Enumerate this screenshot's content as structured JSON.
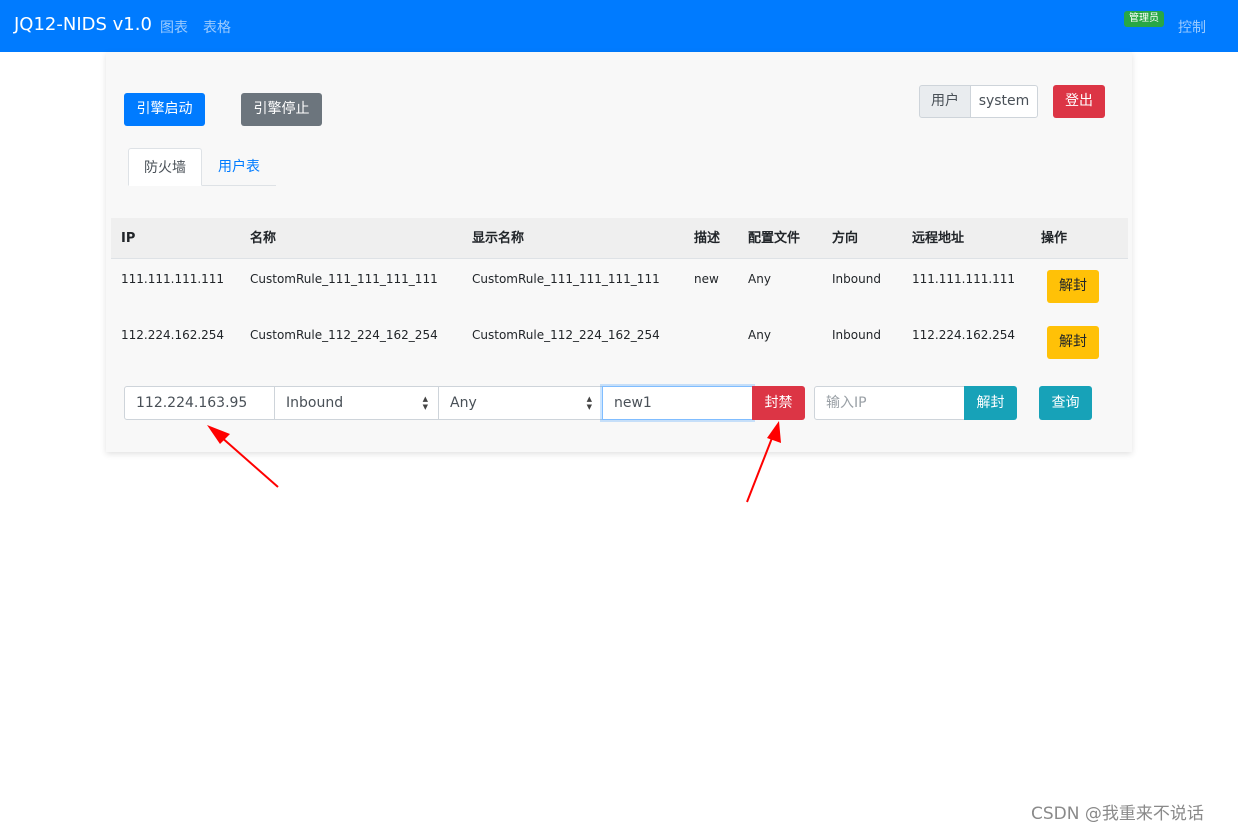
{
  "navbar": {
    "brand": "JQ12-NIDS v1.0",
    "links": [
      "图表",
      "表格"
    ],
    "admin_badge": "管理员",
    "control_link": "控制",
    "color": "#007bff"
  },
  "toolbar": {
    "start_label": "引擎启动",
    "stop_label": "引擎停止",
    "user_prefix": "用户",
    "user_value": "system",
    "logout_label": "登出"
  },
  "tabs": [
    {
      "label": "防火墙",
      "active": true
    },
    {
      "label": "用户表",
      "active": false
    }
  ],
  "table": {
    "headers": [
      "IP",
      "名称",
      "显示名称",
      "描述",
      "配置文件",
      "方向",
      "远程地址",
      "操作"
    ],
    "rows": [
      {
        "ip": "111.111.111.111",
        "name": "CustomRule_111_111_111_111",
        "display_name": "CustomRule_111_111_111_111",
        "desc": "new",
        "profile": "Any",
        "direction": "Inbound",
        "remote": "111.111.111.111",
        "action": "解封"
      },
      {
        "ip": "112.224.162.254",
        "name": "CustomRule_112_224_162_254",
        "display_name": "CustomRule_112_224_162_254",
        "desc": "",
        "profile": "Any",
        "direction": "Inbound",
        "remote": "112.224.162.254",
        "action": "解封"
      }
    ]
  },
  "form": {
    "ip_value": "112.224.163.95",
    "direction_value": "Inbound",
    "profile_value": "Any",
    "desc_value": "new1",
    "block_label": "封禁",
    "unblock_placeholder": "输入IP",
    "unblock_label": "解封",
    "query_label": "查询"
  },
  "watermark": "CSDN @我重来不说话",
  "annotation_color": "#ff0000"
}
